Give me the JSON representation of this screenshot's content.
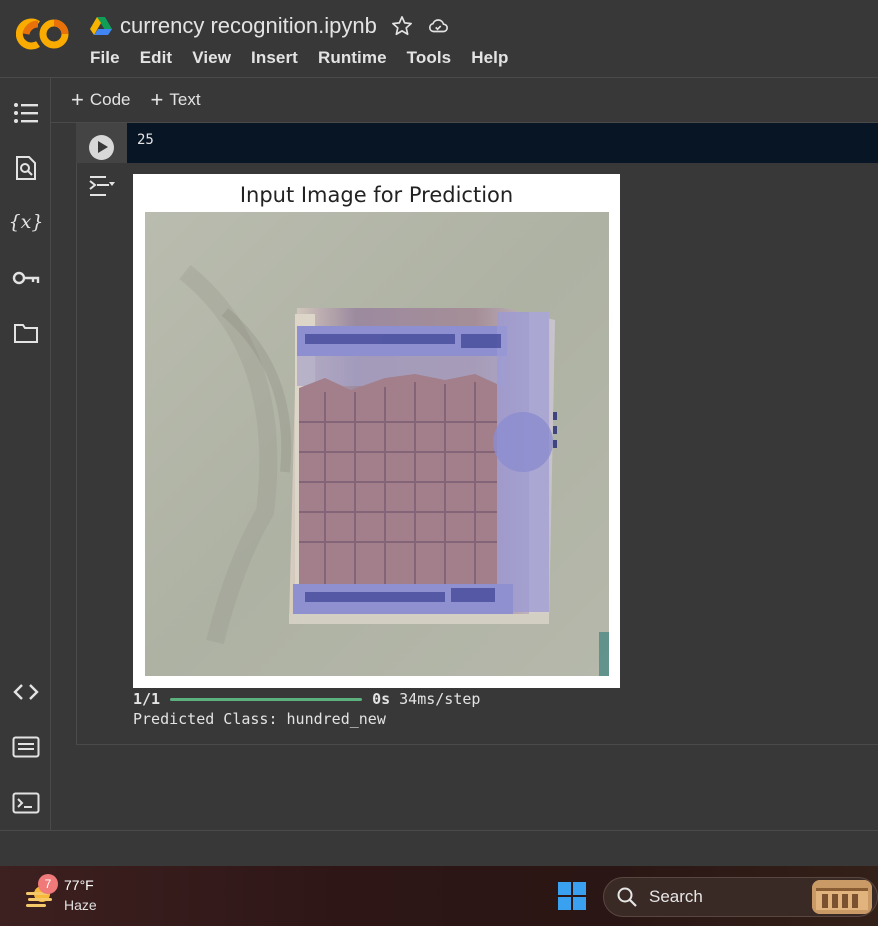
{
  "app": {
    "notebook_title": "currency recognition.ipynb",
    "menu": [
      "File",
      "Edit",
      "View",
      "Insert",
      "Runtime",
      "Tools",
      "Help"
    ]
  },
  "toolbar": {
    "add_code": "Code",
    "add_text": "Text"
  },
  "sidebar": {
    "icons": [
      "table-of-contents-icon",
      "find-replace-icon",
      "variables-icon",
      "secrets-key-icon",
      "files-folder-icon",
      "code-snippets-icon",
      "command-palette-icon",
      "terminal-icon"
    ],
    "variables_label": "{x}"
  },
  "cell": {
    "output_value": "25"
  },
  "figure": {
    "title": "Input Image for Prediction",
    "image_subject": "hundred-rupee-note-photo"
  },
  "output": {
    "progress_steps": "1/1",
    "progress_fraction": 1.0,
    "progress_time": "0s",
    "progress_rate": "34ms/step",
    "prediction": "Predicted Class: hundred_new"
  },
  "taskbar": {
    "weather_badge": "7",
    "temperature": "77°F",
    "condition": "Haze",
    "search_label": "Search"
  },
  "colors": {
    "background": "#383838",
    "code_bg": "#071525",
    "progress": "#5cb27f",
    "colab_orange": "#f9ab00"
  }
}
